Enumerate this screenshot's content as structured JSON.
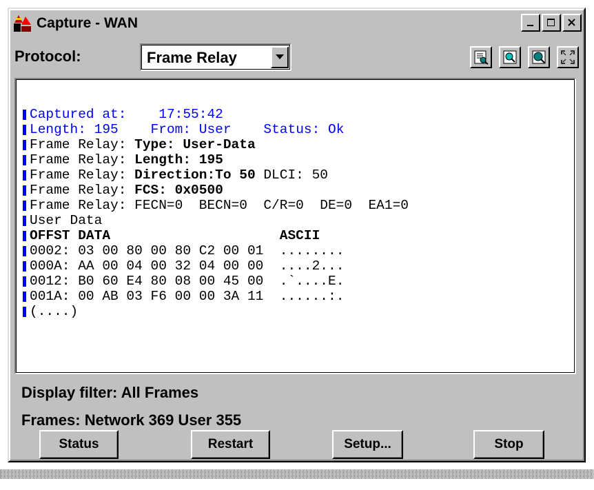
{
  "window": {
    "title": "Capture - WAN"
  },
  "protocol": {
    "label": "Protocol:",
    "value": "Frame Relay"
  },
  "toolbar": {
    "icons": [
      "details-icon",
      "zoom-icon",
      "find-icon",
      "expand-icon"
    ]
  },
  "capture": {
    "line1": {
      "label": "Captured at:",
      "time": "17:55:42"
    },
    "line2": {
      "length": "Length: 195",
      "from": "From: User",
      "status": "Status: Ok"
    },
    "fr_type": {
      "prefix": "Frame Relay: ",
      "value": "Type: User-Data"
    },
    "fr_length": {
      "prefix": "Frame Relay: ",
      "value": "Length: 195"
    },
    "fr_direction": {
      "prefix": "Frame Relay: ",
      "value": "Direction:To 50",
      "extra": " DLCI: 50"
    },
    "fr_fcs": {
      "prefix": "Frame Relay: ",
      "value": "FCS: 0x0500"
    },
    "fr_flags": "Frame Relay: FECN=0  BECN=0  C/R=0  DE=0  EA1=0",
    "user_data": "User Data",
    "header": {
      "offset": "OFFST DATA",
      "ascii": "ASCII"
    },
    "rows": [
      {
        "offset": "0002:",
        "data": "03 00 80 00 80 C2 00 01",
        "ascii": "........"
      },
      {
        "offset": "000A:",
        "data": "AA 00 04 00 32 04 00 00",
        "ascii": "....2..."
      },
      {
        "offset": "0012:",
        "data": "B0 60 E4 80 08 00 45 00",
        "ascii": ".`....E."
      },
      {
        "offset": "001A:",
        "data": "00 AB 03 F6 00 00 3A 11",
        "ascii": "......:."
      }
    ],
    "more": "(....)"
  },
  "status": {
    "filter": "Display filter: All Frames",
    "frames": "Frames: Network 369  User 355"
  },
  "buttons": {
    "status": "Status",
    "restart": "Restart",
    "setup": "Setup...",
    "stop": "Stop"
  },
  "colors": {
    "window_bg": "#c0c0c0",
    "accent_blue": "#0000ff",
    "panel_bg": "#ffffff"
  }
}
